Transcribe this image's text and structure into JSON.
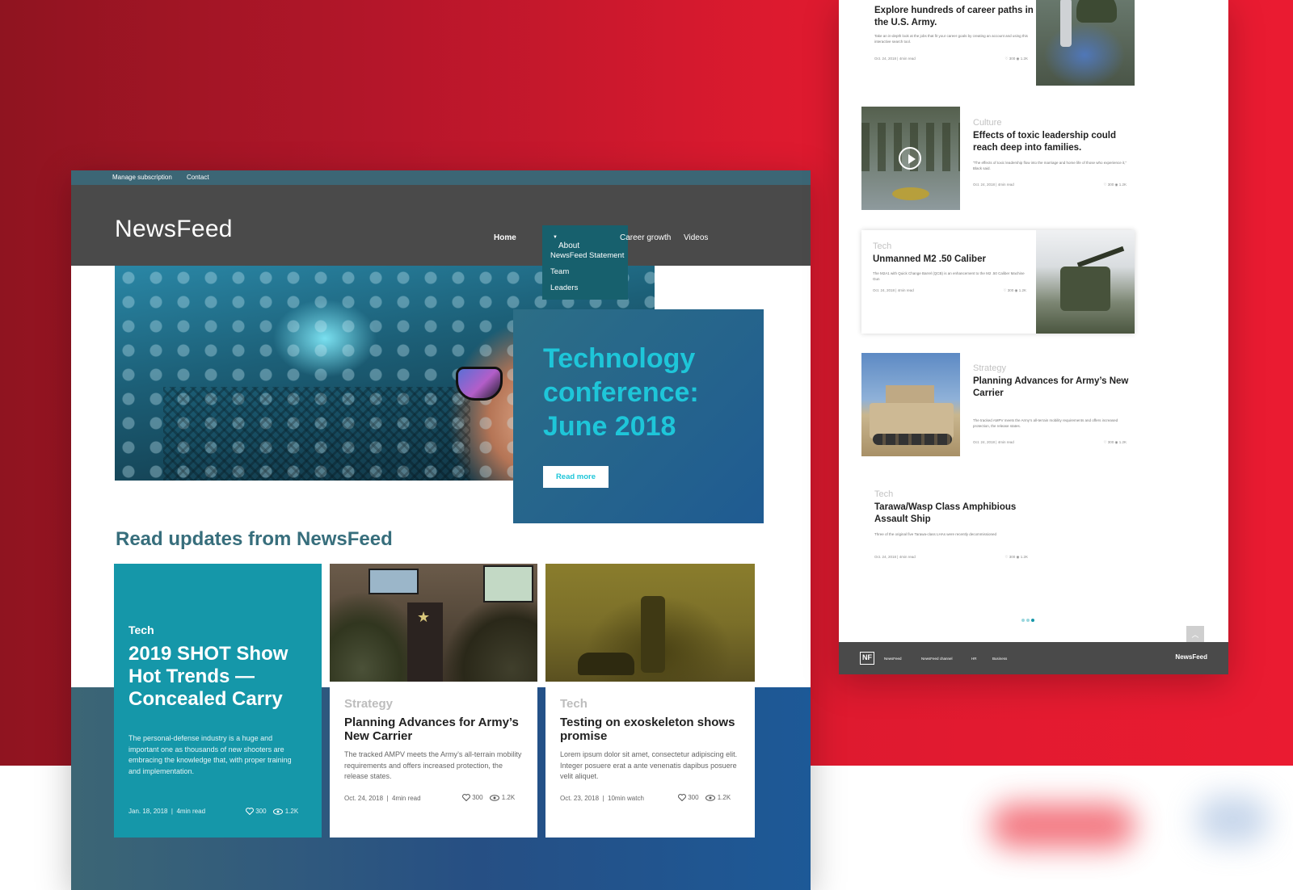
{
  "colors": {
    "accent": "#1ec6d9",
    "teal_card": "#1597a9",
    "header": "#4a4a4a",
    "topbar": "#3c6675",
    "dropdown": "#17606d",
    "background_red": "#dd1a2f"
  },
  "topbar": {
    "manage": "Manage subscription",
    "contact": "Contact"
  },
  "header": {
    "logo": "NewsFeed",
    "nav": {
      "home": "Home",
      "about": "About NewsFeed",
      "career": "Career growth",
      "videos": "Videos"
    },
    "dropdown": [
      "NewsFeed Statement",
      "Team",
      "Leaders"
    ]
  },
  "hero": {
    "title": "Technology conference: June 2018",
    "button": "Read more"
  },
  "section": {
    "title": "Read updates from NewsFeed"
  },
  "cards": [
    {
      "category": "Tech",
      "title": "2019 SHOT Show Hot Trends — Concealed Carry",
      "description": "The personal-defense industry is a huge and important one as thousands of new shooters are embracing the knowledge that, with proper training and implementation.",
      "date": "Jan. 18, 2018",
      "read": "4min read",
      "likes": "300",
      "views": "1.2K"
    },
    {
      "category": "Strategy",
      "title": "Planning Advances for Army’s New Carrier",
      "description": "The tracked AMPV meets the Army’s all-terrain mobility requirements and offers increased protection, the release states.",
      "date": "Oct. 24, 2018",
      "read": "4min read",
      "likes": "300",
      "views": "1.2K"
    },
    {
      "category": "Tech",
      "title": "Testing on exoskeleton shows promise",
      "description": "Lorem ipsum dolor sit amet, consectetur adipiscing elit. Integer posuere erat a ante venenatis dapibus posuere velit aliquet.",
      "date": "Oct. 23, 2018",
      "read": "10min watch",
      "likes": "300",
      "views": "1.2K"
    }
  ],
  "right": {
    "items": [
      {
        "category": "",
        "title": "Explore hundreds of career paths in the U.S. Army.",
        "description": "Take an in-depth look at the jobs that fit your career goals by creating an account and using this interactive search tool.",
        "date": "Oct. 24, 2018",
        "read": "4min read",
        "likes": "300",
        "views": "1.2K"
      },
      {
        "category": "Culture",
        "title": "Effects of toxic leadership could reach deep into families.",
        "description": "“The effects of toxic leadership flow into the marriage and home life of those who experience it,” Black said.",
        "date": "Oct. 24, 2018",
        "read": "4min read",
        "likes": "300",
        "views": "1.2K"
      },
      {
        "category": "Tech",
        "title": "Unmanned M2 .50 Caliber",
        "description": "The M2A1 with Quick Change Barrel (QCB) is an enhancement to the M2 .50 Caliber Machine Gun",
        "date": "Oct. 24, 2018",
        "read": "4min read",
        "likes": "300",
        "views": "1.2K"
      },
      {
        "category": "Strategy",
        "title": "Planning Advances for Army’s New Carrier",
        "description": "The tracked AMPV meets the Army’s all-terrain mobility requirements and offers increased protection, the release states.",
        "date": "Oct. 24, 2018",
        "read": "4min read",
        "likes": "300",
        "views": "1.2K"
      },
      {
        "category": "Tech",
        "title": "Tarawa/Wasp Class Amphibious Assault Ship",
        "description": "Three of the original five Tarawa-class LHAs were recently decommissioned",
        "date": "Oct. 24, 2018",
        "read": "4min read",
        "likes": "300",
        "views": "1.2K"
      }
    ],
    "footer": {
      "logo_mark": "NF",
      "links": [
        "NewsFeed",
        "NewsFeed channel",
        "HR",
        "Business"
      ],
      "brand": "NewsFeed"
    }
  }
}
